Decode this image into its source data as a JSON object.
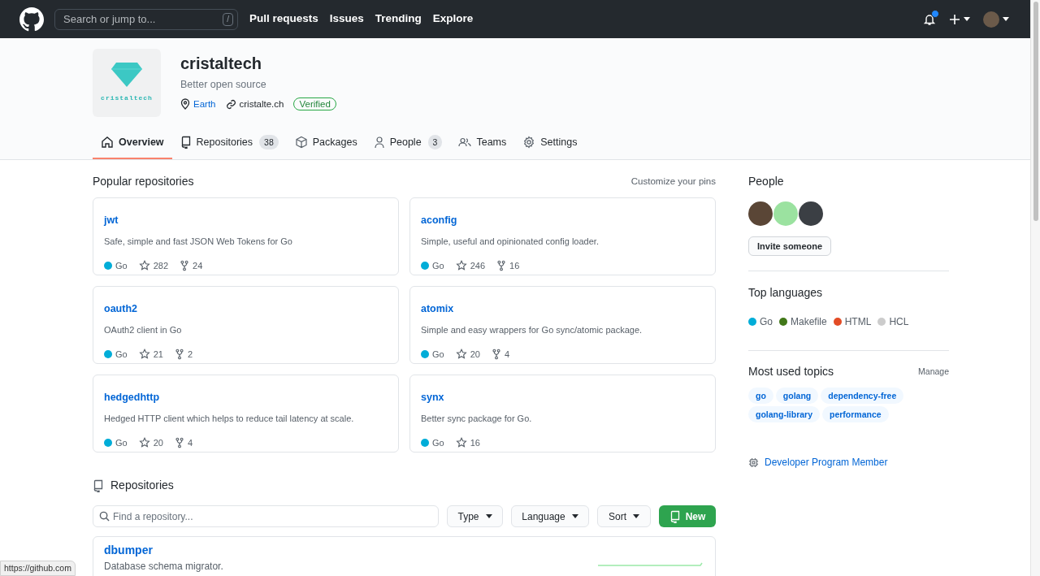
{
  "header": {
    "search_placeholder": "Search or jump to...",
    "shortcut_key": "/",
    "nav": [
      "Pull requests",
      "Issues",
      "Trending",
      "Explore"
    ],
    "has_unread_notifications": true
  },
  "org": {
    "logo_text": "cristaltech",
    "name": "cristaltech",
    "description": "Better open source",
    "location": "Earth",
    "website": "cristalte.ch",
    "badge": "Verified"
  },
  "tabs": [
    {
      "kind": "home",
      "label": "Overview",
      "selected": true
    },
    {
      "kind": "repo",
      "label": "Repositories",
      "count": "38",
      "selected": false
    },
    {
      "kind": "package",
      "label": "Packages",
      "selected": false
    },
    {
      "kind": "person",
      "label": "People",
      "count": "3",
      "selected": false
    },
    {
      "kind": "team",
      "label": "Teams",
      "selected": false
    },
    {
      "kind": "gear",
      "label": "Settings",
      "selected": false
    }
  ],
  "pinned": {
    "title": "Popular repositories",
    "action": "Customize your pins",
    "repos": [
      {
        "name": "jwt",
        "description": "Safe, simple and fast JSON Web Tokens for Go",
        "language": "Go",
        "color": "#00add8",
        "stars": "282",
        "forks": "24"
      },
      {
        "name": "aconfig",
        "description": "Simple, useful and opinionated config loader.",
        "language": "Go",
        "color": "#00add8",
        "stars": "246",
        "forks": "16"
      },
      {
        "name": "oauth2",
        "description": "OAuth2 client in Go",
        "language": "Go",
        "color": "#00add8",
        "stars": "21",
        "forks": "2"
      },
      {
        "name": "atomix",
        "description": "Simple and easy wrappers for Go sync/atomic package.",
        "language": "Go",
        "color": "#00add8",
        "stars": "20",
        "forks": "4"
      },
      {
        "name": "hedgedhttp",
        "description": "Hedged HTTP client which helps to reduce tail latency at scale.",
        "language": "Go",
        "color": "#00add8",
        "stars": "20",
        "forks": "4"
      },
      {
        "name": "synx",
        "description": "Better sync package for Go.",
        "language": "Go",
        "color": "#00add8",
        "stars": "16"
      }
    ]
  },
  "repositories": {
    "title": "Repositories",
    "search_placeholder": "Find a repository...",
    "filters": [
      "Type",
      "Language",
      "Sort"
    ],
    "new_button": "New",
    "items": [
      {
        "name": "dbumper",
        "description": "Database schema migrator."
      }
    ]
  },
  "sidebar": {
    "people_title": "People",
    "invite_button": "Invite someone",
    "languages_title": "Top languages",
    "languages": [
      {
        "name": "Go",
        "color": "#00add8"
      },
      {
        "name": "Makefile",
        "color": "#427819"
      },
      {
        "name": "HTML",
        "color": "#e34c26"
      },
      {
        "name": "HCL",
        "color": "#cccccc"
      }
    ],
    "topics_title": "Most used topics",
    "topics_action": "Manage",
    "topics": [
      "go",
      "golang",
      "dependency-free",
      "golang-library",
      "performance"
    ],
    "badge": "Developer Program Member"
  },
  "status_url": "https://github.com"
}
